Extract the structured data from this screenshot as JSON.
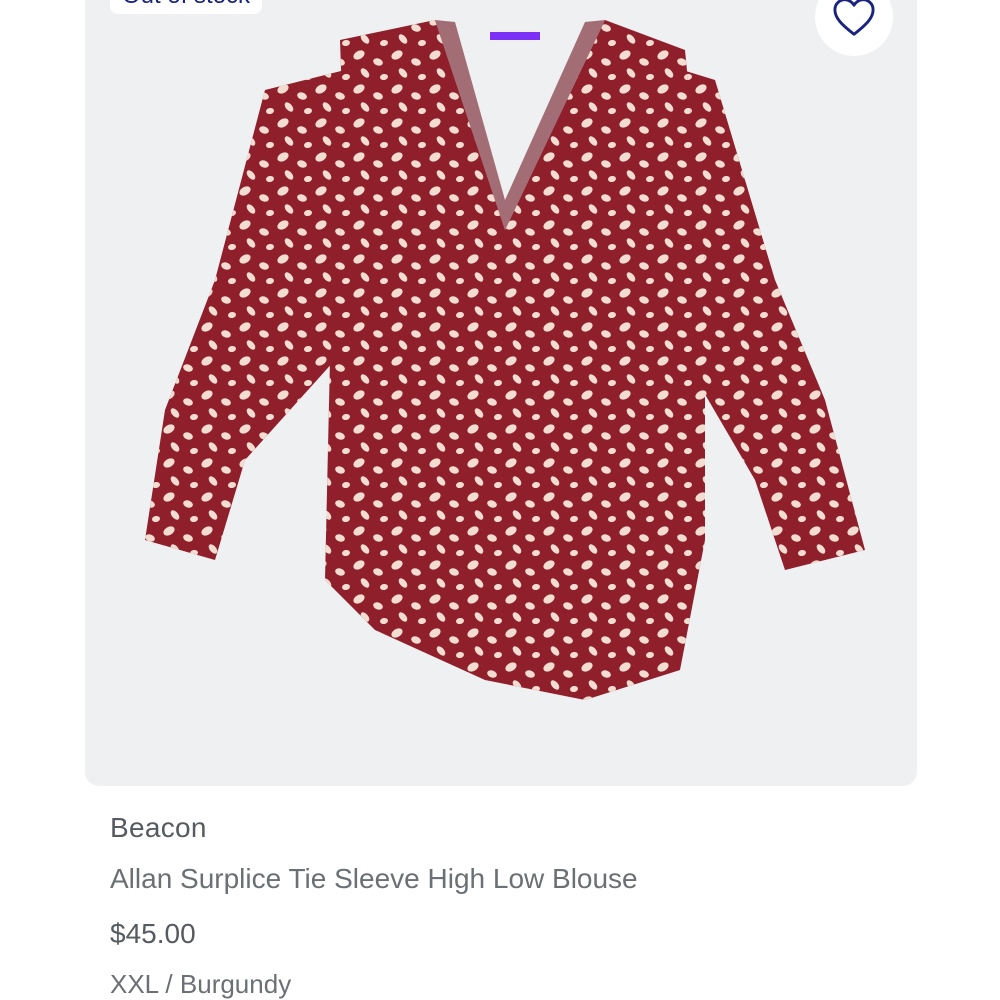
{
  "product": {
    "stock_badge": "Out of stock",
    "brand": "Beacon",
    "title": "Allan Surplice Tie Sleeve High Low Blouse",
    "price": "$45.00",
    "size": "XXL",
    "separator": "/",
    "color_name": "Burgundy"
  },
  "icons": {
    "favorite": "heart-outline-icon"
  },
  "colors": {
    "image_background": "#eef0f2",
    "garment": "#8e1f2b",
    "pattern_dot": "#f3ddd0",
    "accent_navy": "#1a237e",
    "label_purple": "#7b2ff7"
  }
}
